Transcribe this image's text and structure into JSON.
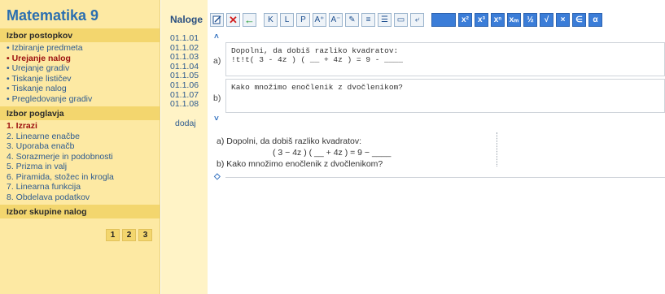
{
  "app_title": "Matematika 9",
  "sections": [
    {
      "heading": "Izbor postopkov",
      "items": [
        {
          "label": "• Izbiranje predmeta",
          "active": false
        },
        {
          "label": "• Urejanje nalog",
          "active": true
        },
        {
          "label": "• Urejanje gradiv",
          "active": false
        },
        {
          "label": "• Tiskanje lističev",
          "active": false
        },
        {
          "label": "• Tiskanje nalog",
          "active": false
        },
        {
          "label": "• Pregledovanje gradiv",
          "active": false
        }
      ]
    },
    {
      "heading": "Izbor poglavja",
      "items": [
        {
          "label": "1. Izrazi",
          "active": true
        },
        {
          "label": "2. Linearne enačbe",
          "active": false
        },
        {
          "label": "3. Uporaba enačb",
          "active": false
        },
        {
          "label": "4. Sorazmerje in podobnosti",
          "active": false
        },
        {
          "label": "5. Prizma in valj",
          "active": false
        },
        {
          "label": "6. Piramida, stožec in krogla",
          "active": false
        },
        {
          "label": "7. Linearna funkcija",
          "active": false
        },
        {
          "label": "8. Obdelava podatkov",
          "active": false
        }
      ]
    },
    {
      "heading": "Izbor skupine nalog",
      "items": []
    }
  ],
  "pager": [
    "1",
    "2",
    "3"
  ],
  "tasks": {
    "heading": "Naloge",
    "codes": [
      "01.1.01",
      "01.1.02",
      "01.1.03",
      "01.1.04",
      "01.1.05",
      "01.1.06",
      "01.1.07",
      "01.1.08"
    ],
    "add_label": "dodaj"
  },
  "toolbar": {
    "buttons": [
      {
        "name": "edit-icon",
        "text": "",
        "style": "w"
      },
      {
        "name": "delete-icon",
        "text": "✕",
        "style": "w red"
      },
      {
        "name": "back-arrow-icon",
        "text": "←",
        "style": "w green"
      },
      {
        "name": "bold-button",
        "text": "K",
        "style": "w"
      },
      {
        "name": "italic-button",
        "text": "L",
        "style": "w"
      },
      {
        "name": "underline-button",
        "text": "P",
        "style": "w"
      },
      {
        "name": "increase-font-icon",
        "text": "A⁺",
        "style": "w"
      },
      {
        "name": "decrease-font-icon",
        "text": "A⁻",
        "style": "w"
      },
      {
        "name": "clear-format-icon",
        "text": "✎",
        "style": "w"
      },
      {
        "name": "numbered-list-icon",
        "text": "≡",
        "style": "w"
      },
      {
        "name": "bullet-list-icon",
        "text": "☰",
        "style": "w"
      },
      {
        "name": "table-icon",
        "text": "▭",
        "style": "w"
      },
      {
        "name": "image-icon",
        "text": "⤶",
        "style": "w"
      },
      {
        "name": "blank-button",
        "text": "",
        "style": "blank"
      },
      {
        "name": "superscript-2-button",
        "text": "x²",
        "style": "b"
      },
      {
        "name": "superscript-3-button",
        "text": "x³",
        "style": "b"
      },
      {
        "name": "superscript-n-button",
        "text": "xⁿ",
        "style": "b"
      },
      {
        "name": "subscript-button",
        "text": "xₘ",
        "style": "b"
      },
      {
        "name": "fraction-button",
        "text": "½",
        "style": "b"
      },
      {
        "name": "sqrt-button",
        "text": "√",
        "style": "b"
      },
      {
        "name": "multiply-button",
        "text": "×",
        "style": "b"
      },
      {
        "name": "element-of-button",
        "text": "∈",
        "style": "b"
      },
      {
        "name": "alpha-button",
        "text": "α",
        "style": "b"
      }
    ]
  },
  "editor": {
    "arrow_up": "˄",
    "arrow_down": "˅",
    "question_a": {
      "label": "a)",
      "line1": "Dopolni, da dobiš razliko kvadratov:",
      "line2": "!t!t( 3 - 4z ) ( __ + 4z ) = 9 - ____"
    },
    "question_b": {
      "label": "b)",
      "line1": "Kako množimo enočlenik z dvočlenikom?"
    }
  },
  "preview": {
    "line1": "a) Dopolni, da dobiš razliko kvadratov:",
    "line2": "( 3 − 4z ) ( __ + 4z ) = 9 − ____",
    "line3": "b) Kako množimo enočlenik z dvočlenikom?",
    "diamond": "◇"
  }
}
